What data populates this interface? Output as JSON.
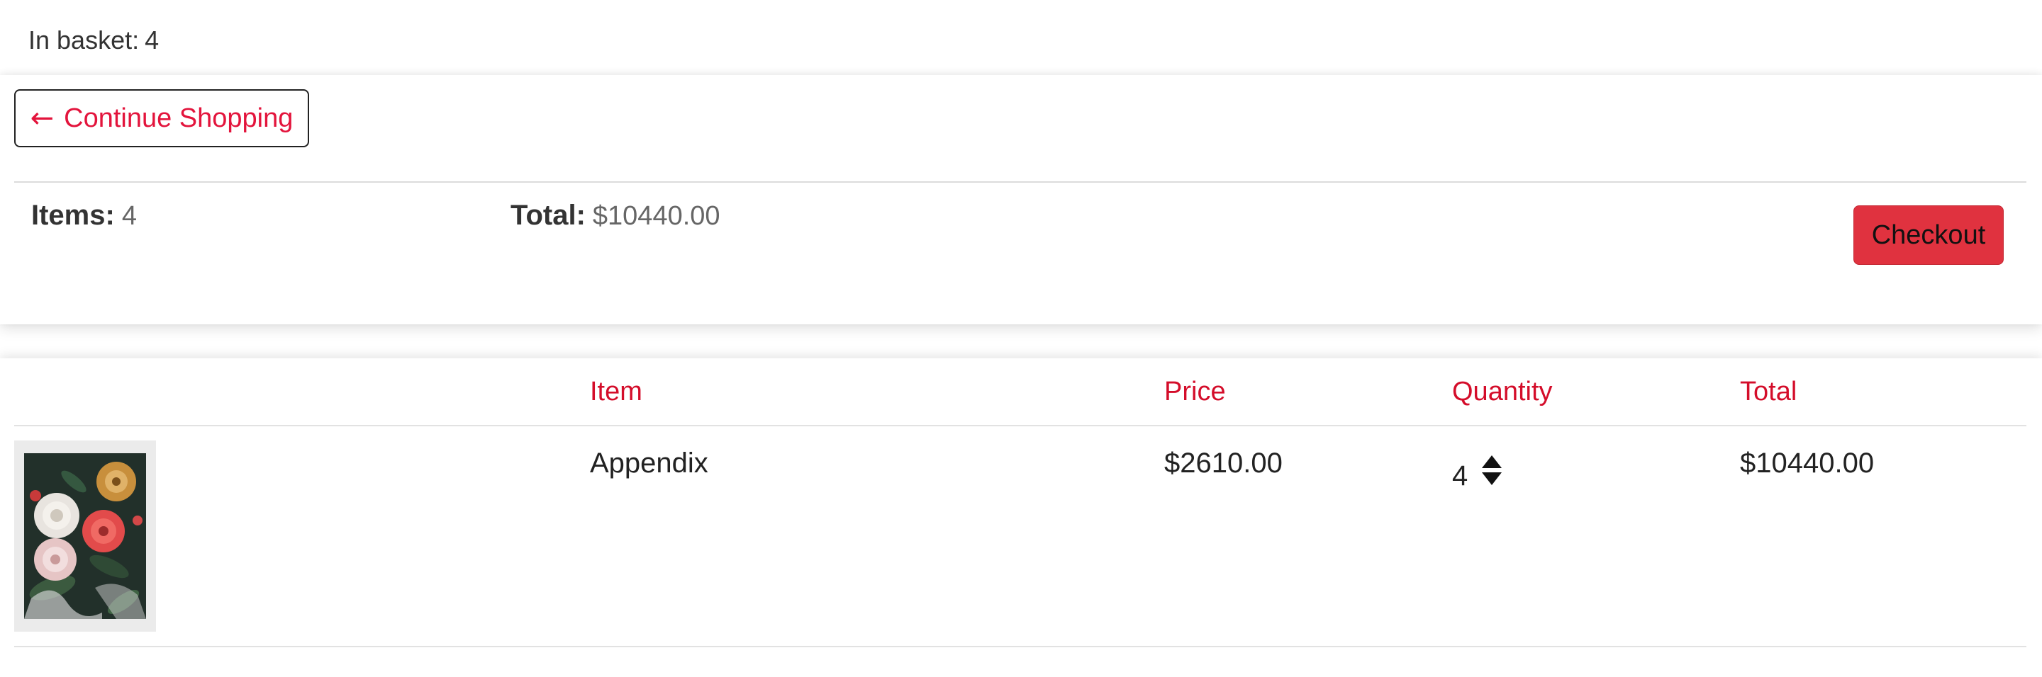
{
  "basket_indicator": {
    "label": "In basket:",
    "count": "4"
  },
  "summary": {
    "continue_label": "Continue Shopping",
    "items_label": "Items:",
    "items_value": "4",
    "total_label": "Total:",
    "total_value": "$10440.00",
    "checkout_label": "Checkout"
  },
  "table": {
    "columns": [
      "Item",
      "Price",
      "Quantity",
      "Total"
    ],
    "rows": [
      {
        "item": "Appendix",
        "price": "$2610.00",
        "quantity": "4",
        "total": "$10440.00",
        "thumbnail": "floral-painting"
      }
    ]
  },
  "colors": {
    "accent": "#e3143c",
    "checkout_bg": "#e0323f",
    "header_text": "#d40d2a"
  },
  "icons": {
    "back": "arrow-left-icon",
    "stepper_up": "triangle-up-icon",
    "stepper_down": "triangle-down-icon"
  }
}
